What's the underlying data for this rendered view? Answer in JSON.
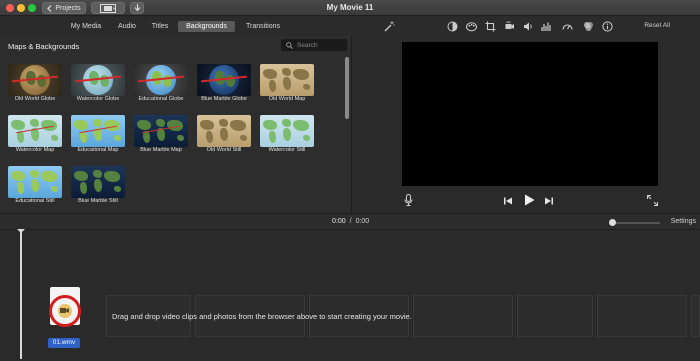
{
  "window": {
    "title": "My Movie 11"
  },
  "toolbar": {
    "projects_label": "Projects",
    "media_icon": "filmstrip-icon",
    "import_icon": "download-arrow-icon"
  },
  "tabs": [
    {
      "label": "My Media",
      "active": false
    },
    {
      "label": "Audio",
      "active": false
    },
    {
      "label": "Titles",
      "active": false
    },
    {
      "label": "Backgrounds",
      "active": true
    },
    {
      "label": "Transitions",
      "active": false
    }
  ],
  "adjust_bar": {
    "tools": [
      "magic-wand-icon",
      "color-balance-icon",
      "color-correction-icon",
      "crop-icon",
      "stabilization-icon",
      "volume-icon",
      "noise-reduction-icon",
      "speed-icon",
      "clip-filter-icon",
      "info-icon"
    ],
    "reset_label": "Reset All"
  },
  "browser": {
    "title": "Maps & Backgrounds",
    "search_placeholder": "Search",
    "items": [
      {
        "label": "Old World Globe",
        "kind": "globe",
        "style": "old"
      },
      {
        "label": "Watercolor Globe",
        "kind": "globe",
        "style": "water"
      },
      {
        "label": "Educational Globe",
        "kind": "globe",
        "style": "edu"
      },
      {
        "label": "Blue Marble Globe",
        "kind": "globe",
        "style": "blue"
      },
      {
        "label": "Old World Map",
        "kind": "map",
        "style": "old"
      },
      {
        "label": "Watercolor Map",
        "kind": "map",
        "style": "water"
      },
      {
        "label": "Educational Map",
        "kind": "map",
        "style": "edu"
      },
      {
        "label": "Blue Marble Map",
        "kind": "map",
        "style": "blue"
      },
      {
        "label": "Old World Still",
        "kind": "map",
        "style": "old"
      },
      {
        "label": "Watercolor Still",
        "kind": "map",
        "style": "water"
      },
      {
        "label": "Educational Still",
        "kind": "map",
        "style": "edu"
      },
      {
        "label": "Blue Marble Still",
        "kind": "map",
        "style": "blue"
      }
    ]
  },
  "viewer": {
    "controls": [
      "microphone-icon",
      "skip-back-icon",
      "play-icon",
      "skip-forward-icon",
      "fullscreen-icon"
    ]
  },
  "timebar": {
    "current": "0:00",
    "separator": "/",
    "total": "0:00",
    "settings_label": "Settings"
  },
  "timeline": {
    "drop_hint": "Drag and drop video clips and photos from the browser above to start creating your movie.",
    "file_label": "01.wmv"
  },
  "colors": {
    "accent_blue": "#2f62c9",
    "badge_red": "#d41e1e",
    "route_red": "#d22a2a"
  }
}
